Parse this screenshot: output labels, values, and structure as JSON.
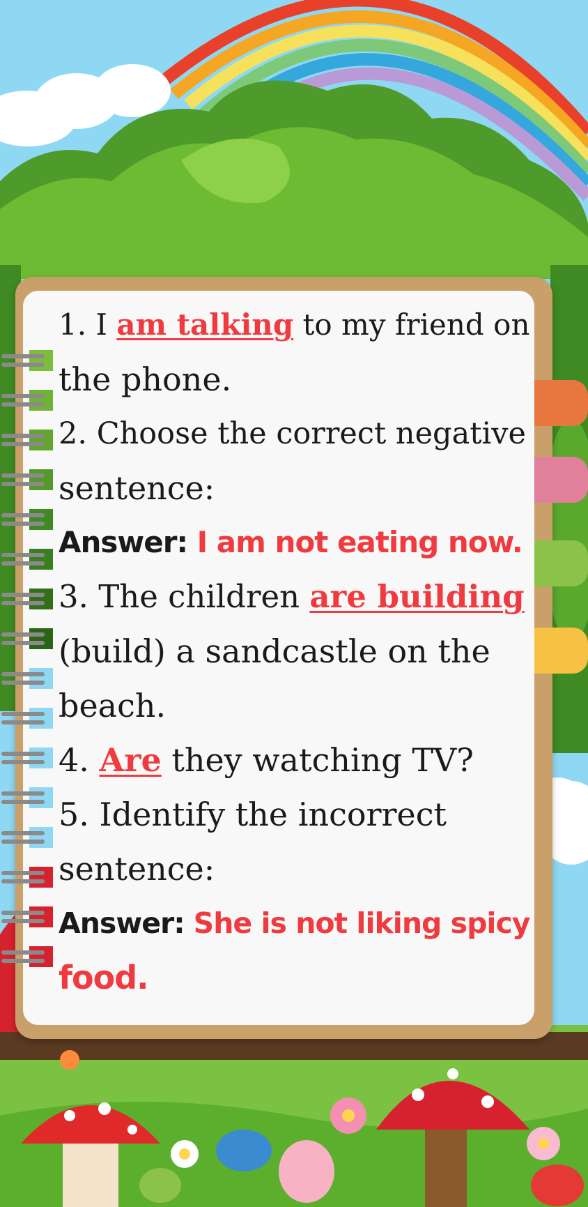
{
  "colors": {
    "sky": "#8fd8f4",
    "answer_red": "#ef3b3f",
    "frame": "#c9a06a",
    "page": "#f8f8f8"
  },
  "questions": [
    {
      "line1_pre": "1. I ",
      "line1_answer": "am talking",
      "line1_post": " to my friend on",
      "line2": "the phone."
    },
    {
      "line1": "2. Choose the correct negative",
      "line2": "sentence:",
      "answer_label": "Answer:",
      "answer_text": "I am not eating now."
    },
    {
      "line1_pre": "3. The children ",
      "line1_answer": "are building",
      "line2": "(build) a sandcastle on the",
      "line3": "beach."
    },
    {
      "line1_pre": "4. ",
      "line1_answer": "Are",
      "line1_post": " they watching TV?"
    },
    {
      "line1": "5. Identify the incorrect",
      "line2": "sentence:",
      "answer_label": "Answer:",
      "answer_text": "She is not liking spicy",
      "answer_text2": "food."
    }
  ]
}
